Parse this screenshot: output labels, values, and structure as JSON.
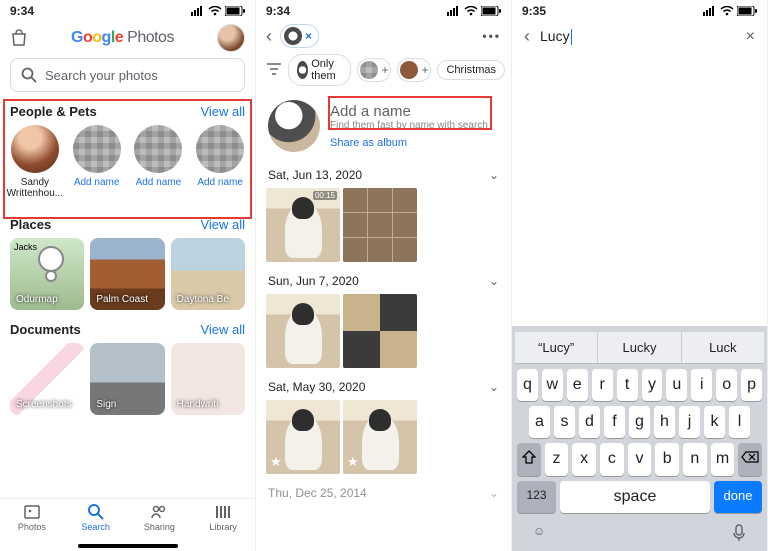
{
  "status": {
    "s1": "9:34",
    "s2": "9:34",
    "s3": "9:35"
  },
  "s1": {
    "logo_word2": "Photos",
    "search_placeholder": "Search your photos",
    "people_head": "People & Pets",
    "view_all": "View all",
    "people": [
      {
        "label": "Sandy Writtenhou..."
      },
      {
        "label": "Add name"
      },
      {
        "label": "Add name"
      },
      {
        "label": "Add name"
      }
    ],
    "places_head": "Places",
    "places": [
      {
        "label": "Odurmap",
        "badge": "Jacks"
      },
      {
        "label": "Palm Coast"
      },
      {
        "label": "Daytona Be"
      }
    ],
    "docs_head": "Documents",
    "docs": [
      {
        "label": "Screenshots"
      },
      {
        "label": "Sign"
      },
      {
        "label": "Handwriti"
      }
    ],
    "nav": {
      "photos": "Photos",
      "search": "Search",
      "sharing": "Sharing",
      "library": "Library"
    }
  },
  "s2": {
    "chips": {
      "only": "Only them",
      "xmas": "Christmas"
    },
    "add_title": "Add a name",
    "add_sub": "Find them fast by name with search",
    "share": "Share as album",
    "dates": {
      "d1": "Sat, Jun 13, 2020",
      "d2": "Sun, Jun 7, 2020",
      "d3": "Sat, May 30, 2020",
      "d4": "Thu, Dec 25, 2014"
    },
    "ts1": "00:15"
  },
  "s3": {
    "value": "Lucy",
    "suggestions": [
      "“Lucy”",
      "Lucky",
      "Luck"
    ],
    "rows": [
      "qwertyuiop",
      "asdfghjkl",
      "zxcvbnm"
    ],
    "num": "123",
    "space": "space",
    "done": "done"
  }
}
